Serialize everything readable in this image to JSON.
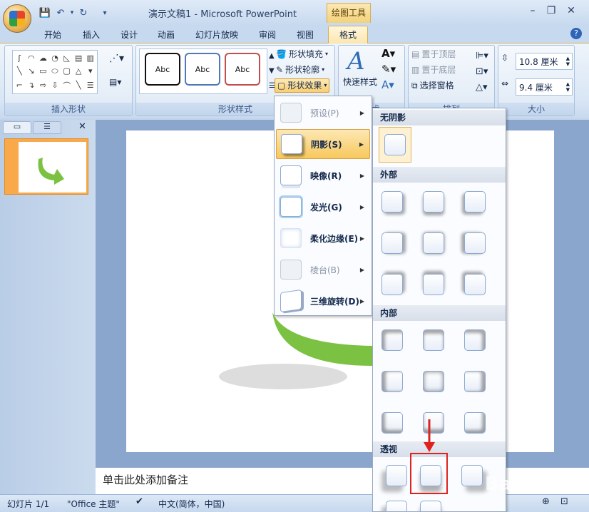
{
  "app": {
    "doc_title": "演示文稿1 - Microsoft PowerPoint",
    "context_tab": "绘图工具",
    "tabs": [
      "开始",
      "插入",
      "设计",
      "动画",
      "幻灯片放映",
      "审阅",
      "视图"
    ],
    "format_tab": "格式"
  },
  "ribbon": {
    "insert_shapes_label": "插入形状",
    "shape_styles_label": "形状样式",
    "style_sample": "Abc",
    "fill": "形状填充",
    "outline": "形状轮廓",
    "effects": "形状效果",
    "quick_styles": "快速样式",
    "art_label": "艺术",
    "bring_front": "置于顶层",
    "send_back": "置于底层",
    "selection_pane": "选择窗格",
    "arrange_label": "排列",
    "height": "10.8 厘米",
    "width": "9.4 厘米",
    "size_label": "大小"
  },
  "effects_menu": {
    "items": [
      {
        "label": "预设(P)",
        "disabled": true
      },
      {
        "label": "阴影(S)",
        "disabled": false
      },
      {
        "label": "映像(R)",
        "disabled": false
      },
      {
        "label": "发光(G)",
        "disabled": false
      },
      {
        "label": "柔化边缘(E)",
        "disabled": false
      },
      {
        "label": "棱台(B)",
        "disabled": true
      },
      {
        "label": "三维旋转(D)",
        "disabled": false
      }
    ]
  },
  "shadow_gallery": {
    "no_shadow": "无阴影",
    "outer": "外部",
    "inner": "内部",
    "perspective": "透视"
  },
  "slide_panel": {
    "slide_number": "1"
  },
  "notes": {
    "placeholder": "单击此处添加备注"
  },
  "status": {
    "slide": "幻灯片 1/1",
    "theme": "\"Office 主题\"",
    "language": "中文(简体，中国)"
  },
  "watermark": "Baidu 经验",
  "colors": {
    "accent": "#f7c85c",
    "shape_green": "#7cc242",
    "highlight": "#e0221f"
  }
}
